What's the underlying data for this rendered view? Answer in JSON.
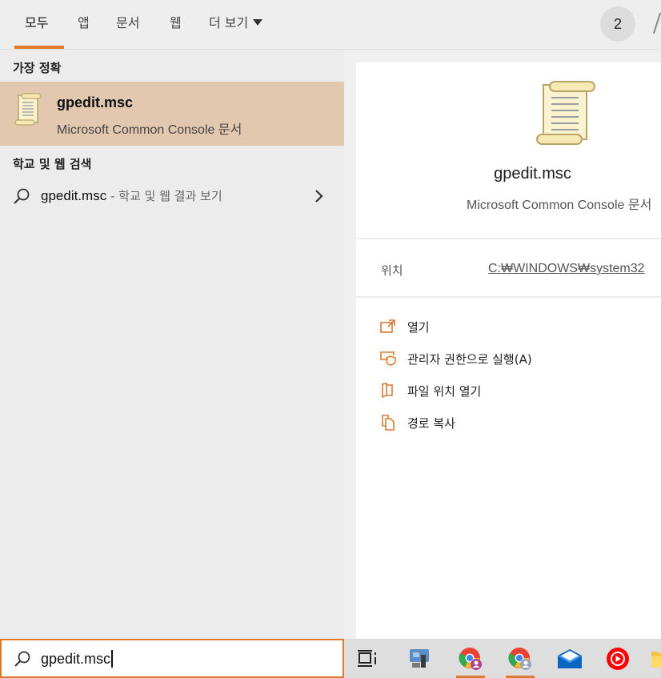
{
  "tabs": [
    {
      "label": "모두",
      "active": true
    },
    {
      "label": "앱"
    },
    {
      "label": "문서"
    },
    {
      "label": "웹"
    },
    {
      "label": "더 보기"
    }
  ],
  "badge": "2",
  "best_match": {
    "heading": "가장 정확",
    "title": "gpedit.msc",
    "subtitle": "Microsoft Common Console 문서",
    "icon": "console-document-icon"
  },
  "web_search": {
    "heading": "학교 및 웹 검색",
    "query": "gpedit.msc",
    "suffix": " - 학교 및 웹 결과 보기"
  },
  "preview": {
    "title": "gpedit.msc",
    "subtitle": "Microsoft Common Console 문서",
    "location_label": "위치",
    "location_value": "C:₩WINDOWS₩system32",
    "actions": [
      {
        "label": "열기",
        "icon": "open-icon"
      },
      {
        "label": "관리자 권한으로 실행(A)",
        "icon": "run-as-admin-icon"
      },
      {
        "label": "파일 위치 열기",
        "icon": "open-file-location-icon"
      },
      {
        "label": "경로 복사",
        "icon": "copy-path-icon"
      }
    ]
  },
  "search": {
    "value": "gpedit.msc"
  },
  "taskbar": [
    {
      "name": "task-view",
      "active": false
    },
    {
      "name": "network-app",
      "active": false
    },
    {
      "name": "chrome-profile-1",
      "active": true
    },
    {
      "name": "chrome-profile-2",
      "active": true
    },
    {
      "name": "mail",
      "active": false
    },
    {
      "name": "youtube-music",
      "active": false
    },
    {
      "name": "file-explorer",
      "active": false
    }
  ],
  "colors": {
    "accent": "#dd7a2c",
    "selection": "#e3c8b0",
    "panel": "#ececec"
  }
}
